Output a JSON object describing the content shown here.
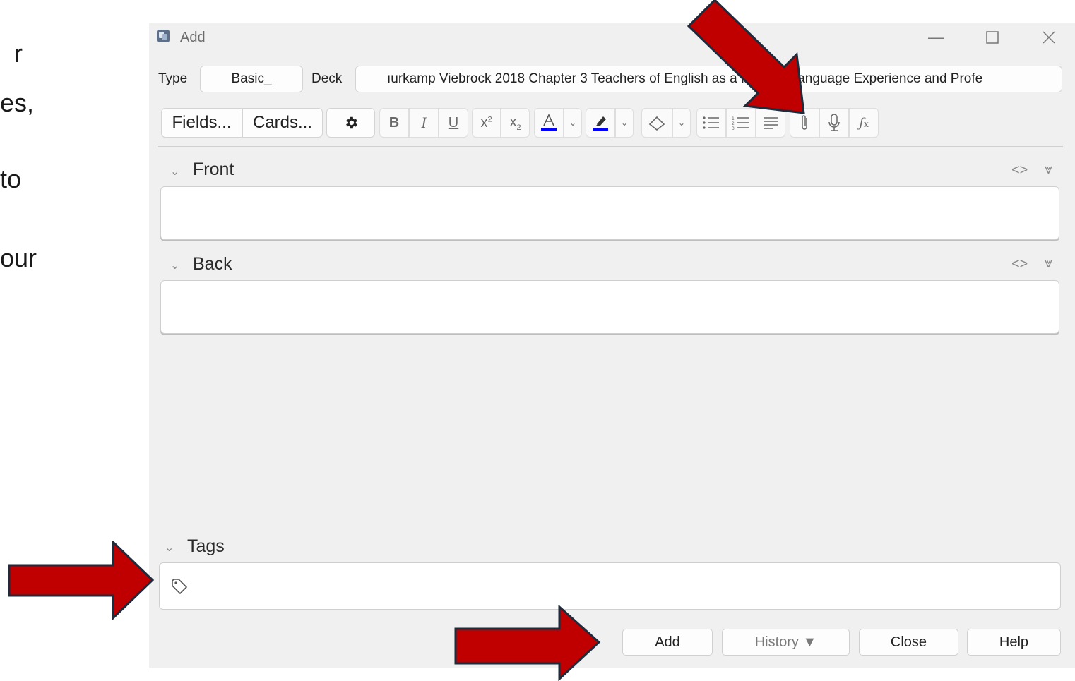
{
  "background_fragments": [
    "r",
    "es,",
    "to",
    "our"
  ],
  "window": {
    "title": "Add"
  },
  "selectors": {
    "type_label": "Type",
    "type_value": "Basic_",
    "deck_label": "Deck",
    "deck_value": "ıurkamp Viebrock 2018 Chapter 3 Teachers of English as a Foreign Language Experience and Profe"
  },
  "toolbar": {
    "fields_label": "Fields...",
    "cards_label": "Cards..."
  },
  "fields": [
    {
      "label": "Front"
    },
    {
      "label": "Back"
    }
  ],
  "tags": {
    "label": "Tags"
  },
  "buttons": {
    "add": "Add",
    "history": "History ▼",
    "close": "Close",
    "help": "Help"
  },
  "colors": {
    "arrow": "#c00000",
    "arrow_outline": "#1f2a3a",
    "color_underline": "#0000ff"
  }
}
